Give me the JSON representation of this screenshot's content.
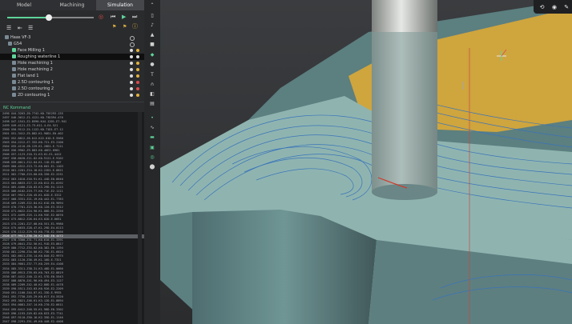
{
  "tabs": [
    "Model",
    "Machining",
    "Simulation"
  ],
  "active_tab": "Simulation",
  "playback": {
    "progress": 0.48
  },
  "tree": [
    {
      "label": "Haas VF-3",
      "indent": 0
    },
    {
      "label": "G54",
      "indent": 1
    },
    {
      "label": "Face Milling 1",
      "indent": 2
    },
    {
      "label": "Roughing waterline 1",
      "indent": 2,
      "selected": true
    },
    {
      "label": "Hole machining 1",
      "indent": 2
    },
    {
      "label": "Hole machining 2",
      "indent": 2
    },
    {
      "label": "Flat land 1",
      "indent": 2
    },
    {
      "label": "2.5D contouring 1",
      "indent": 2
    },
    {
      "label": "2.5D contouring 2",
      "indent": 2
    },
    {
      "label": "2D contouring 1",
      "indent": 2
    }
  ],
  "nc_header": "NC Kommand",
  "nc_lines": [
    "2496 X44.3263-Z0.7742-K0.75E293.135",
    "2497 X46.3612-Z1.4121-K0.73D394.476",
    "2498 X47.1541-Z2.8590-K44.12D1-E7.941",
    "2499 X49.4121-Z3.73-K11.4-E4.521",
    "2500 X50.9112-Z4.1122-K0.71D1-E7.12",
    "2501 X51.3412-Z5.882-K1.90D1-E0.402",
    "2502 X52.8812-Z6.012-K22.01D-E.5560",
    "2503 X54.2212-Z7.332-K0.721-E3.2100",
    "2504 X55.4110-Z8.129-K1.20D1-E.7111",
    "2505 X56.9902-Z9.883-K0.46E2.0981",
    "2506 X57.1123-Z10.31-K3.01-E1.4412",
    "2507 X58.6620-Z11.82-K0.9121-E.9102",
    "2508 X59.0011-Z12.04-K1.11D-E3.007",
    "2509 X60.4512-Z13.72-K0.602-E1.1103",
    "2510 X61.2201-Z14.18-K2.22D1-E.8821",
    "2511 X62.7700-Z15.60-K0.330-E2.2231",
    "2512 X63.1010-Z16.91-K1.44D-E0.6640",
    "2513 X64.8833-Z17.22-K0.812-E1.0192",
    "2514 X65.4400-Z18.03-K3.29D-E4.1115",
    "2515 X66.0102-Z19.77-K0.71E-E2.1111",
    "2516 X67.9921-Z20.45-K1.02D-E.3312",
    "2517 X68.3331-Z21.19-K0.442-E1.7783",
    "2518 X69.1209-Z22.84-K2.61D-E0.9094",
    "2519 X70.7701-Z23.36-K0.120-E3.3312",
    "2520 X71.0022-Z24.90-K1.88D-E1.2250",
    "2521 X72.4499-Z25.11-K0.93E-E2.0076",
    "2522 X73.8812-Z26.64-K3.02D-E.6651",
    "2523 X74.2201-Z27.08-K0.551-E1.9980",
    "2524 X75.6633-Z28.47-K1.29D-E4.0113",
    "2525 X76.1112-Z29.93-K0.778-E2.5566",
    "2526 X77.9911-Z30.20-K2.04D-E0.4472",
    "2527 X78.3300-Z31.71-K0.610-E1.3391",
    "2528 X79.0041-Z32.56-K1.91D-E3.8817",
    "2529 X80.7712-Z33.02-K0.382-E0.1194",
    "2530 X81.2290-Z34.88-K2.73D-E1.6624",
    "2531 X82.6611-Z35.14-K0.840-E2.9975",
    "2532 X83.1120-Z36.49-K1.16D-E.7321",
    "2533 X84.9001-Z37.77-K0.259-E4.4108",
    "2534 X85.3311-Z38.31-K3.48D-E1.0066",
    "2535 X86.0913-Z39.65-K0.703-E2.8819",
    "2536 X87.4412-Z40.12-K1.57D-E0.5543",
    "2537 X88.8870-Z41.96-K0.494-E3.1127",
    "2538 X89.2209-Z42.40-K2.80D-E1.4478",
    "2539 X90.5511-Z43.03-K0.926-E2.2209",
    "2540 X91.1100-Z44.87-K1.33D-E.9935",
    "2541 X92.7730-Z45.29-K0.617-E4.5520",
    "2542 X93.3021-Z46.61-K3.12D-E1.8894",
    "2543 X94.0081-Z47.14-K0.270-E2.6611",
    "2544 X95.6412-Z48.55-K1.98D-E0.3302",
    "2545 X96.1193-Z49.82-K0.833-E3.7741",
    "2546 X97.9110-Z50.16-K2.35D-E1.1146",
    "2547 X98.2291-Z51.49-K0.448-E2.4408",
    "2548 X99.7701-Z52.03-K1.64D-E.8873",
    "2549 X100.02-Z53.78-K0.562-E4.2255"
  ],
  "nc_highlight_index": 30,
  "colors": {
    "accent": "#5fd49a",
    "stock": "#8fb4b0",
    "top_face": "#cfa53e",
    "tool": "#c9ccc9",
    "path": "#3a74b8"
  }
}
